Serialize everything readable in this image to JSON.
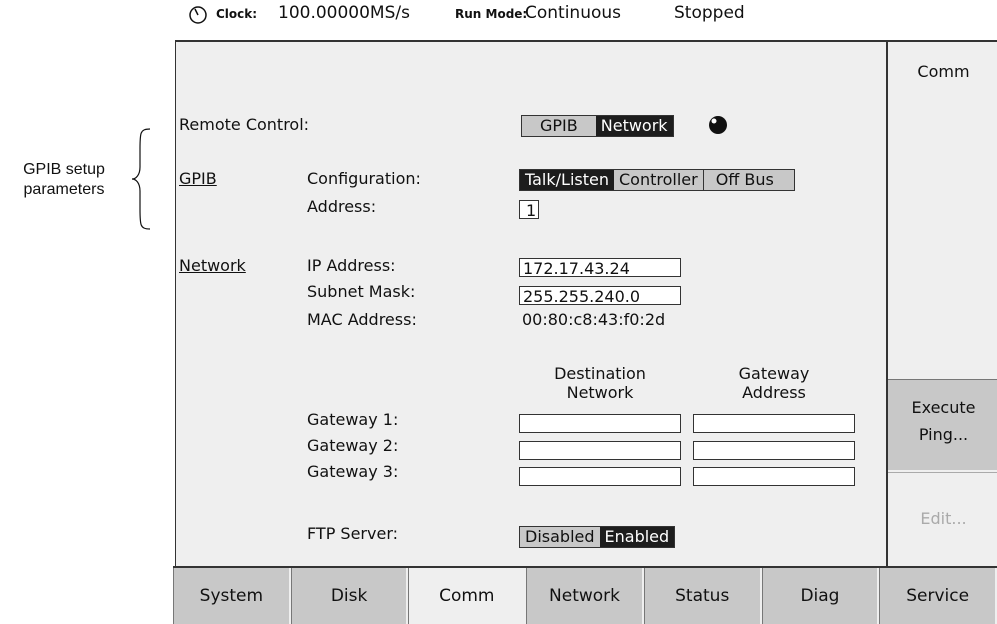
{
  "annotation": {
    "line1": "GPIB setup",
    "line2": "parameters"
  },
  "status_bar": {
    "clock_label": "Clock:",
    "clock_value": "100.00000MS/s",
    "run_mode_label": "Run Mode:",
    "run_mode_value": "Continuous",
    "state": "Stopped"
  },
  "remote_control": {
    "label": "Remote Control:",
    "options": [
      "GPIB",
      "Network"
    ],
    "selected": "Network"
  },
  "gpib": {
    "section_label": "GPIB",
    "configuration_label": "Configuration:",
    "configuration_options": [
      "Talk/Listen",
      "Controller",
      "Off Bus"
    ],
    "configuration_selected": "Talk/Listen",
    "address_label": "Address:",
    "address_value": "1"
  },
  "network": {
    "section_label": "Network",
    "ip_label": "IP Address:",
    "ip_value": "172.17.43.24",
    "subnet_label": "Subnet Mask:",
    "subnet_value": "255.255.240.0",
    "mac_label": "MAC Address:",
    "mac_value": "00:80:c8:43:f0:2d"
  },
  "gateways": {
    "dest_header_1": "Destination",
    "dest_header_2": "Network",
    "gw_header_1": "Gateway",
    "gw_header_2": "Address",
    "rows": [
      {
        "label": "Gateway 1:",
        "dest": "",
        "addr": ""
      },
      {
        "label": "Gateway 2:",
        "dest": "",
        "addr": ""
      },
      {
        "label": "Gateway 3:",
        "dest": "",
        "addr": ""
      }
    ]
  },
  "ftp": {
    "label": "FTP Server:",
    "options": [
      "Disabled",
      "Enabled"
    ],
    "selected": "Enabled"
  },
  "side_menu": {
    "title": "Comm",
    "execute_line1": "Execute",
    "execute_line2": "Ping...",
    "edit": "Edit..."
  },
  "tabs": [
    "System",
    "Disk",
    "Comm",
    "Network",
    "Status",
    "Diag",
    "Service"
  ],
  "active_tab": "Comm",
  "colors": {
    "selected": "#1d1d1d",
    "unselected": "#c8c8c8",
    "panel": "#efefef"
  }
}
